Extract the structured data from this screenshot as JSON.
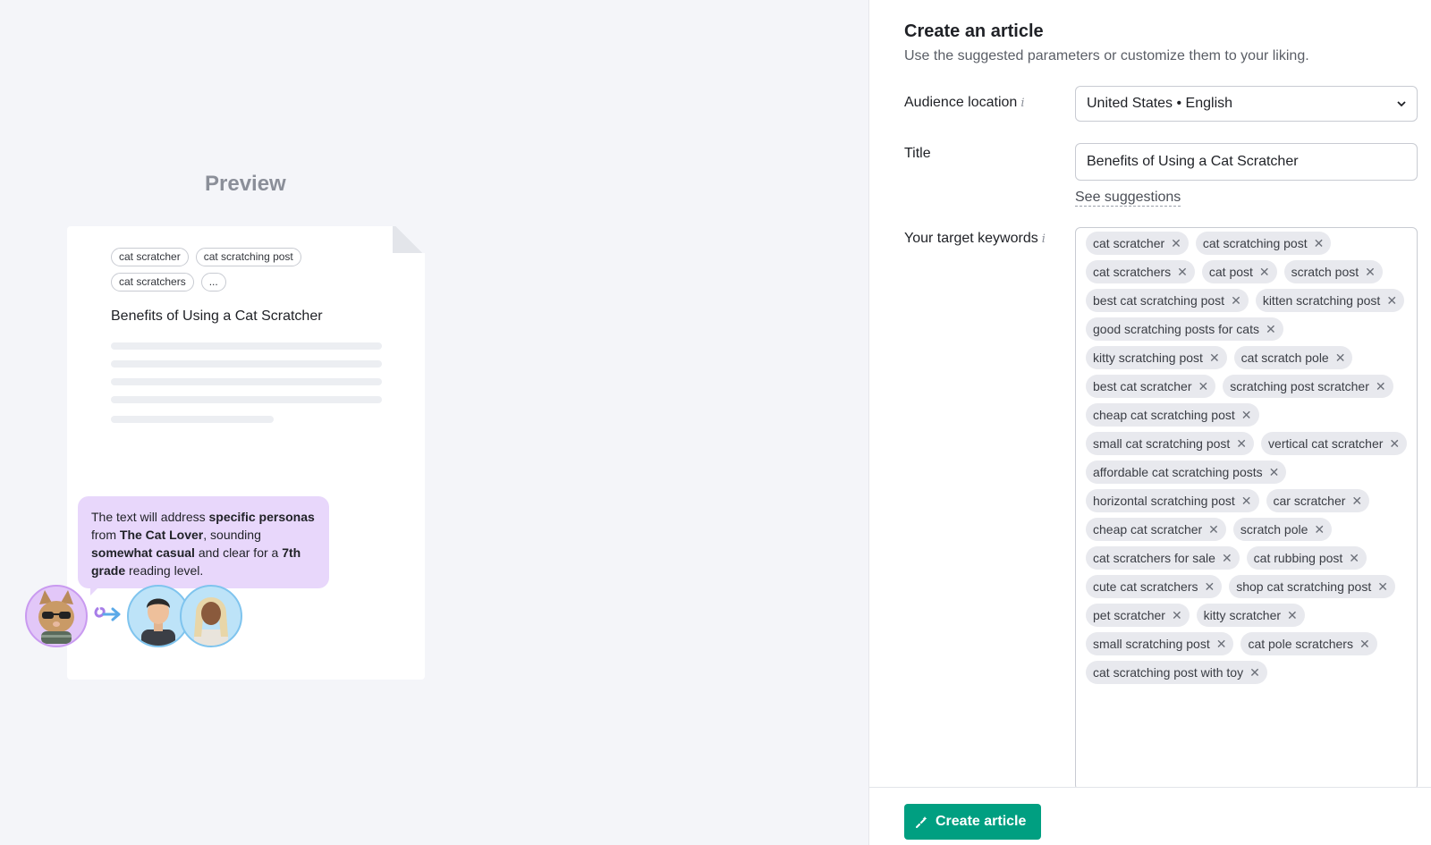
{
  "preview": {
    "heading": "Preview",
    "chips": [
      "cat scratcher",
      "cat scratching post",
      "cat scratchers",
      "..."
    ],
    "doc_title": "Benefits of Using a Cat Scratcher",
    "bubble": {
      "t1": "The text will address ",
      "b1": "specific personas",
      "t2": " from ",
      "b2": "The Cat Lover",
      "t3": ", sounding ",
      "b3": "somewhat casual",
      "t4": " and clear for a ",
      "b4": "7th grade",
      "t5": " reading level."
    },
    "avatars": [
      "cat-avatar",
      "man-avatar",
      "woman-avatar"
    ]
  },
  "form": {
    "title": "Create an article",
    "subtitle": "Use the suggested parameters or customize them to your liking.",
    "audience_label": "Audience location",
    "audience_value": "United States • English",
    "title_label": "Title",
    "title_value": "Benefits of Using a Cat Scratcher",
    "see_suggestions": "See suggestions",
    "keywords_label": "Your target keywords",
    "keywords": [
      "cat scratcher",
      "cat scratching post",
      "cat scratchers",
      "cat post",
      "scratch post",
      "best cat scratching post",
      "kitten scratching post",
      "good scratching posts for cats",
      "kitty scratching post",
      "cat scratch pole",
      "best cat scratcher",
      "scratching post scratcher",
      "cheap cat scratching post",
      "small cat scratching post",
      "vertical cat scratcher",
      "affordable cat scratching posts",
      "horizontal scratching post",
      "car scratcher",
      "cheap cat scratcher",
      "scratch pole",
      "cat scratchers for sale",
      "cat rubbing post",
      "cute cat scratchers",
      "shop cat scratching post",
      "pet scratcher",
      "kitty scratcher",
      "small scratching post",
      "cat pole scratchers",
      "cat scratching post with toy"
    ],
    "remove_glyph": "✕",
    "create_button": "Create article"
  },
  "colors": {
    "accent": "#009f81",
    "bubble": "#e8d7fb",
    "chip_bg": "#e8e9ee"
  }
}
